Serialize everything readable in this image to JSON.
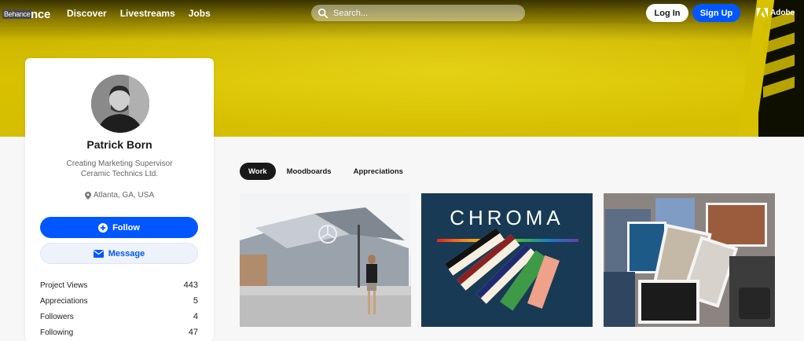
{
  "header": {
    "logo_tag": "Behance",
    "logo_text": "ance",
    "nav": [
      "Discover",
      "Livestreams",
      "Jobs"
    ],
    "search_placeholder": "Search...",
    "login_label": "Log In",
    "signup_label": "Sign Up",
    "adobe_label": "Adobe"
  },
  "profile": {
    "name": "Patrick Born",
    "occupation_line1": "Creating Marketing Supervisor",
    "occupation_line2": "Ceramic Technics Ltd.",
    "location": "Atlanta, GA, USA",
    "follow_label": "Follow",
    "message_label": "Message",
    "stats": [
      {
        "label": "Project Views",
        "value": "443"
      },
      {
        "label": "Appreciations",
        "value": "5"
      },
      {
        "label": "Followers",
        "value": "4"
      },
      {
        "label": "Following",
        "value": "47"
      }
    ]
  },
  "tabs": [
    "Work",
    "Moodboards",
    "Appreciations"
  ],
  "active_tab": "Work",
  "projects": {
    "p2_title": "CHROMA"
  },
  "colors": {
    "accent": "#0057ff",
    "banner": "#d5bd00"
  }
}
